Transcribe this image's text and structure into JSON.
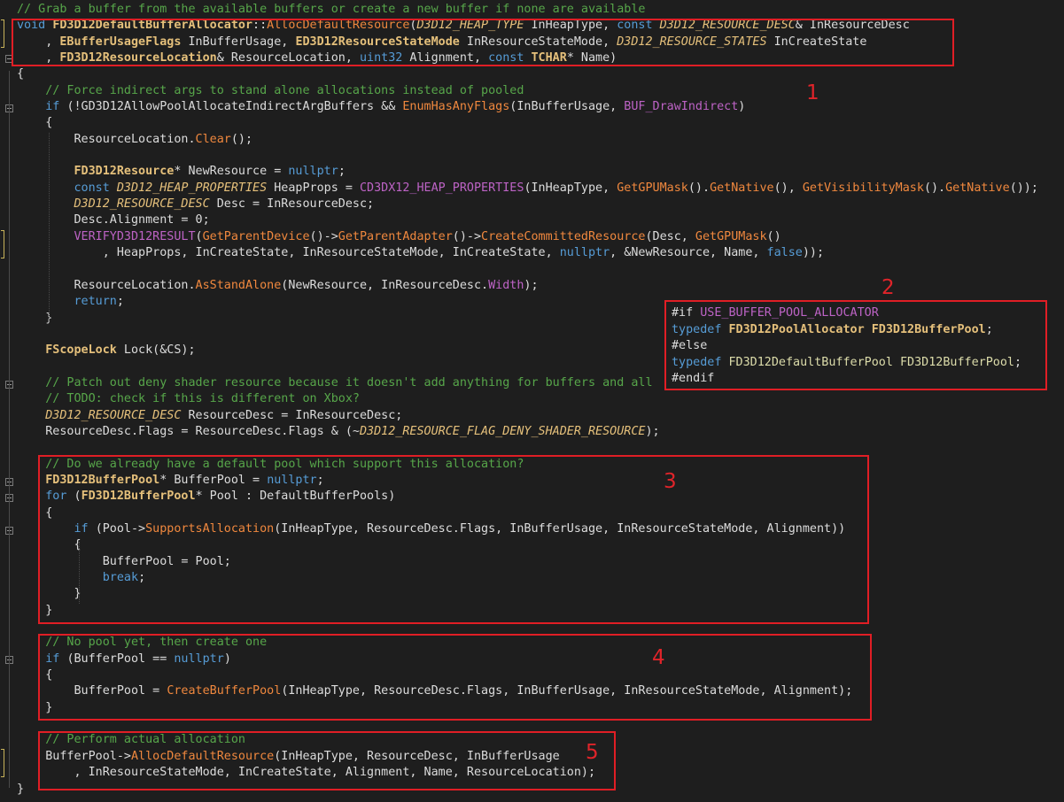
{
  "editor": {
    "annotations": [
      "1",
      "2",
      "3",
      "4",
      "5"
    ],
    "lines": [
      [
        [
          "c",
          "// Grab a buffer from the available buffers or create a new buffer if none are available"
        ]
      ],
      [
        [
          "k",
          "void "
        ],
        [
          "cls",
          "FD3D12DefaultBufferAllocator"
        ],
        [
          "",
          "::"
        ],
        [
          "fn",
          "AllocDefaultResource"
        ],
        [
          "",
          "("
        ],
        [
          "tp",
          "D3D12_HEAP_TYPE"
        ],
        [
          "",
          " InHeapType, "
        ],
        [
          "k",
          "const "
        ],
        [
          "tp",
          "D3D12_RESOURCE_DESC"
        ],
        [
          "",
          "& InResourceDesc"
        ]
      ],
      [
        [
          "",
          "    , "
        ],
        [
          "cls",
          "EBufferUsageFlags"
        ],
        [
          "",
          " InBufferUsage, "
        ],
        [
          "cls",
          "ED3D12ResourceStateMode"
        ],
        [
          "",
          " InResourceStateMode, "
        ],
        [
          "tp",
          "D3D12_RESOURCE_STATES"
        ],
        [
          "",
          " InCreateState"
        ]
      ],
      [
        [
          "",
          "    , "
        ],
        [
          "cls",
          "FD3D12ResourceLocation"
        ],
        [
          "",
          "& ResourceLocation, "
        ],
        [
          "k",
          "uint32"
        ],
        [
          "",
          " Alignment, "
        ],
        [
          "k",
          "const "
        ],
        [
          "cls",
          "TCHAR"
        ],
        [
          "",
          "* Name)"
        ]
      ],
      [
        [
          "",
          "{"
        ]
      ],
      [
        [
          "c",
          "    // Force indirect args to stand alone allocations instead of pooled"
        ]
      ],
      [
        [
          "k",
          "    if "
        ],
        [
          "",
          "(!GD3D12AllowPoolAllocateIndirectArgBuffers && "
        ],
        [
          "fn",
          "EnumHasAnyFlags"
        ],
        [
          "",
          "(InBufferUsage, "
        ],
        [
          "mac",
          "BUF_DrawIndirect"
        ],
        [
          "",
          ")"
        ]
      ],
      [
        [
          "",
          "    {"
        ]
      ],
      [
        [
          "",
          "        ResourceLocation."
        ],
        [
          "fn",
          "Clear"
        ],
        [
          "",
          "();"
        ]
      ],
      [
        [
          "",
          ""
        ]
      ],
      [
        [
          "",
          "        "
        ],
        [
          "cls",
          "FD3D12Resource"
        ],
        [
          "",
          "* NewResource = "
        ],
        [
          "k",
          "nullptr"
        ],
        [
          "",
          ";"
        ]
      ],
      [
        [
          "k",
          "        const "
        ],
        [
          "tp",
          "D3D12_HEAP_PROPERTIES"
        ],
        [
          "",
          " HeapProps = "
        ],
        [
          "mac",
          "CD3DX12_HEAP_PROPERTIES"
        ],
        [
          "",
          "(InHeapType, "
        ],
        [
          "fn",
          "GetGPUMask"
        ],
        [
          "",
          "()."
        ],
        [
          "fn",
          "GetNative"
        ],
        [
          "",
          "(), "
        ],
        [
          "fn",
          "GetVisibilityMask"
        ],
        [
          "",
          "()."
        ],
        [
          "fn",
          "GetNative"
        ],
        [
          "",
          "());"
        ]
      ],
      [
        [
          "tp",
          "        D3D12_RESOURCE_DESC"
        ],
        [
          "",
          " Desc = InResourceDesc;"
        ]
      ],
      [
        [
          "",
          "        Desc.Alignment = "
        ],
        [
          "",
          "0;"
        ]
      ],
      [
        [
          "mac",
          "        VERIFYD3D12RESULT"
        ],
        [
          "",
          "("
        ],
        [
          "fn",
          "GetParentDevice"
        ],
        [
          "",
          "()->"
        ],
        [
          "fn",
          "GetParentAdapter"
        ],
        [
          "",
          "()->"
        ],
        [
          "fn",
          "CreateCommittedResource"
        ],
        [
          "",
          "(Desc, "
        ],
        [
          "fn",
          "GetGPUMask"
        ],
        [
          "",
          "()"
        ]
      ],
      [
        [
          "",
          "            , HeapProps, InCreateState, InResourceStateMode, InCreateState, "
        ],
        [
          "k",
          "nullptr"
        ],
        [
          "",
          ", &NewResource, Name, "
        ],
        [
          "k",
          "false"
        ],
        [
          "",
          "));"
        ]
      ],
      [
        [
          "",
          ""
        ]
      ],
      [
        [
          "",
          "        ResourceLocation."
        ],
        [
          "fn",
          "AsStandAlone"
        ],
        [
          "",
          "(NewResource, InResourceDesc."
        ],
        [
          "mac",
          "Width"
        ],
        [
          "",
          ");"
        ]
      ],
      [
        [
          "k",
          "        return"
        ],
        [
          "",
          ";"
        ]
      ],
      [
        [
          "",
          "    }"
        ]
      ],
      [
        [
          "",
          ""
        ]
      ],
      [
        [
          "cls",
          "    FScopeLock"
        ],
        [
          "",
          " Lock(&CS);"
        ]
      ],
      [
        [
          "",
          ""
        ]
      ],
      [
        [
          "c",
          "    // Patch out deny shader resource because it doesn't add anything for buffers and all"
        ]
      ],
      [
        [
          "c",
          "    // TODO: check if this is different on Xbox?"
        ]
      ],
      [
        [
          "tp",
          "    D3D12_RESOURCE_DESC"
        ],
        [
          "",
          " ResourceDesc = InResourceDesc;"
        ]
      ],
      [
        [
          "",
          "    ResourceDesc.Flags = ResourceDesc.Flags & (~"
        ],
        [
          "tp",
          "D3D12_RESOURCE_FLAG_DENY_SHADER_RESOURCE"
        ],
        [
          "",
          ");"
        ]
      ],
      [
        [
          "",
          ""
        ]
      ],
      [
        [
          "c",
          "    // Do we already have a default pool which support this allocation?"
        ]
      ],
      [
        [
          "cls",
          "    FD3D12BufferPool"
        ],
        [
          "",
          "* BufferPool = "
        ],
        [
          "k",
          "nullptr"
        ],
        [
          "",
          ";"
        ]
      ],
      [
        [
          "k",
          "    for "
        ],
        [
          "",
          "("
        ],
        [
          "cls",
          "FD3D12BufferPool"
        ],
        [
          "",
          "* Pool : DefaultBufferPools)"
        ]
      ],
      [
        [
          "",
          "    {"
        ]
      ],
      [
        [
          "k",
          "        if "
        ],
        [
          "",
          "(Pool->"
        ],
        [
          "fn",
          "SupportsAllocation"
        ],
        [
          "",
          "(InHeapType, ResourceDesc.Flags, InBufferUsage, InResourceStateMode, Alignment))"
        ]
      ],
      [
        [
          "",
          "        {"
        ]
      ],
      [
        [
          "",
          "            BufferPool = Pool;"
        ]
      ],
      [
        [
          "k",
          "            break"
        ],
        [
          "",
          ";"
        ]
      ],
      [
        [
          "",
          "        }"
        ]
      ],
      [
        [
          "",
          "    }"
        ]
      ],
      [
        [
          "",
          ""
        ]
      ],
      [
        [
          "c",
          "    // No pool yet, then create one"
        ]
      ],
      [
        [
          "k",
          "    if "
        ],
        [
          "",
          "(BufferPool == "
        ],
        [
          "k",
          "nullptr"
        ],
        [
          "",
          ")"
        ]
      ],
      [
        [
          "",
          "    {"
        ]
      ],
      [
        [
          "",
          "        BufferPool = "
        ],
        [
          "fn",
          "CreateBufferPool"
        ],
        [
          "",
          "(InHeapType, ResourceDesc.Flags, InBufferUsage, InResourceStateMode, Alignment);"
        ]
      ],
      [
        [
          "",
          "    }"
        ]
      ],
      [
        [
          "",
          ""
        ]
      ],
      [
        [
          "c",
          "    // Perform actual allocation"
        ]
      ],
      [
        [
          "",
          "    BufferPool->"
        ],
        [
          "fn",
          "AllocDefaultResource"
        ],
        [
          "",
          "(InHeapType, ResourceDesc, InBufferUsage"
        ]
      ],
      [
        [
          "",
          "        , InResourceStateMode, InCreateState, Alignment, Name, ResourceLocation);"
        ]
      ],
      [
        [
          "",
          "}"
        ]
      ]
    ],
    "popup": [
      [
        [
          "",
          "#if "
        ],
        [
          "mac",
          "USE_BUFFER_POOL_ALLOCATOR"
        ]
      ],
      [
        [
          "k",
          "typedef "
        ],
        [
          "cls",
          "FD3D12PoolAllocator"
        ],
        [
          "",
          " "
        ],
        [
          "cls",
          "FD3D12BufferPool"
        ],
        [
          "",
          ";"
        ]
      ],
      [
        [
          "",
          "#else"
        ]
      ],
      [
        [
          "k",
          "typedef "
        ],
        [
          "mem",
          "FD3D12DefaultBufferPool"
        ],
        [
          "",
          " "
        ],
        [
          "mem",
          "FD3D12BufferPool"
        ],
        [
          "",
          ";"
        ]
      ],
      [
        [
          "",
          "#endif"
        ]
      ]
    ]
  }
}
